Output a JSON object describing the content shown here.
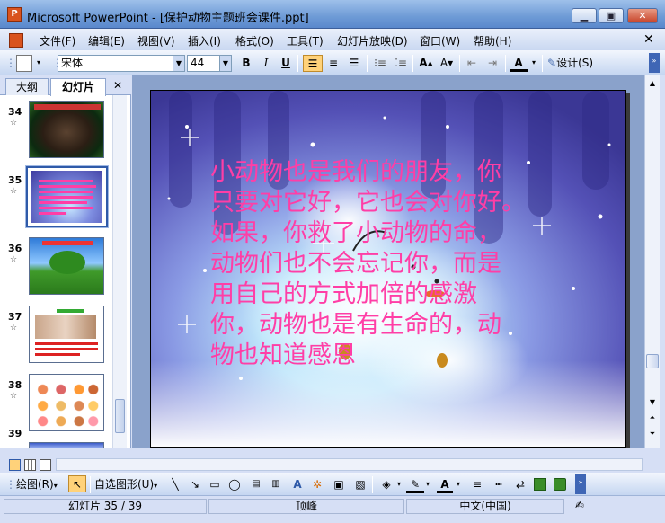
{
  "window": {
    "title": "Microsoft PowerPoint - [保护动物主题班会课件.ppt]",
    "app_icon_letter": "P"
  },
  "menu": {
    "items": [
      "文件(F)",
      "编辑(E)",
      "视图(V)",
      "插入(I)",
      "格式(O)",
      "工具(T)",
      "幻灯片放映(D)",
      "窗口(W)",
      "帮助(H)"
    ]
  },
  "toolbar": {
    "font_name": "宋体",
    "font_size": "44",
    "bold_label": "B",
    "italic_label": "I",
    "underline_label": "U",
    "design_label": "设计(S)"
  },
  "panel": {
    "tabs": [
      "大纲",
      "幻灯片"
    ],
    "selected_tab": "幻灯片",
    "thumbnails": [
      {
        "number": "34",
        "star": "☆"
      },
      {
        "number": "35",
        "star": "☆",
        "selected": true
      },
      {
        "number": "36",
        "star": "☆"
      },
      {
        "number": "37",
        "star": "☆"
      },
      {
        "number": "38",
        "star": "☆"
      },
      {
        "number": "39",
        "star": ""
      }
    ]
  },
  "slide": {
    "text_lines": [
      "小动物也是我们的朋友，你",
      "只要对它好，它也会对你好。",
      "如果，你救了小动物的命，",
      "动物们也不会忘记你，而是",
      "用自己的方式加倍的感激",
      "你，动物也是有生命的，动",
      "物也知道感恩"
    ],
    "text_color": "#ff3ea6"
  },
  "drawbar": {
    "draw_label": "绘图(R)",
    "autoshapes_label": "自选图形(U)"
  },
  "status": {
    "slide_position": "幻灯片 35 / 39",
    "template": "顶峰",
    "language": "中文(中国)"
  },
  "colors": {
    "titlebar": "#6e9bd6",
    "selection": "#2f5aa8"
  }
}
